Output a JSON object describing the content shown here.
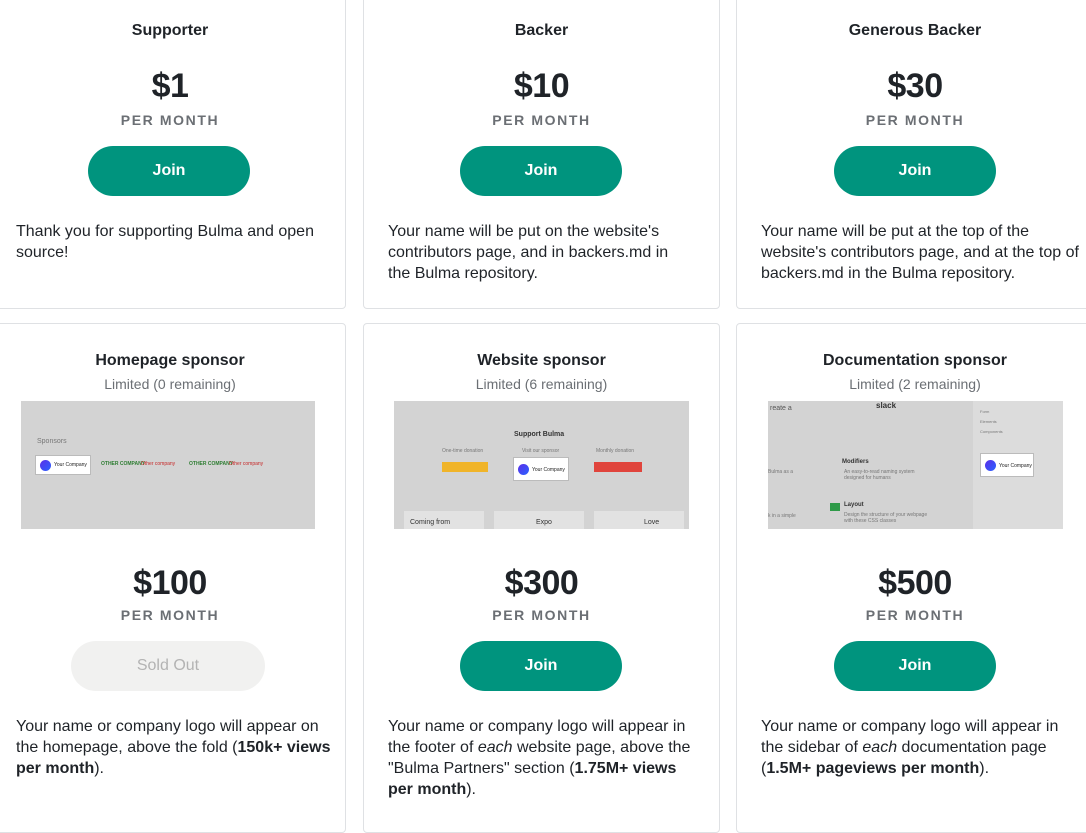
{
  "tiers": [
    {
      "name": "Supporter",
      "price": "$1",
      "period": "PER MONTH",
      "button": "Join",
      "desc": "Thank you for supporting Bulma and open source!"
    },
    {
      "name": "Backer",
      "price": "$10",
      "period": "PER MONTH",
      "button": "Join",
      "desc": "Your name will be put on the website's contributors page, and in backers.md in the Bulma repository."
    },
    {
      "name": "Generous Backer",
      "price": "$30",
      "period": "PER MONTH",
      "button": "Join",
      "desc": "Your name will be put at the top of the website's contributors page, and at the top of backers.md in the Bulma repository."
    },
    {
      "name": "Homepage sponsor",
      "limited": "Limited (0 remaining)",
      "price": "$100",
      "period": "PER MONTH",
      "button": "Sold Out",
      "desc_1": "Your name or company logo will appear on the homepage, above the fold (",
      "desc_bold": "150k+ views per month",
      "desc_2": ").",
      "preview": {
        "label": "Sponsors",
        "your_company": "Your Company",
        "other_company": "Other company",
        "other_company_2": "OTHER COMPANY"
      }
    },
    {
      "name": "Website sponsor",
      "limited": "Limited (6 remaining)",
      "price": "$300",
      "period": "PER MONTH",
      "button": "Join",
      "desc_1": "Your name or company logo will appear in the footer of ",
      "desc_em": "each",
      "desc_2": " website page, above the \"Bulma Partners\" section (",
      "desc_bold": "1.75M+ views per month",
      "desc_3": ").",
      "preview": {
        "title": "Support Bulma",
        "one_time": "One-time donation",
        "visit": "Visit our sponsor",
        "monthly": "Monthly donation",
        "paypal": "PayPal Donate",
        "your_company": "Your Company",
        "coming_from": "Coming from",
        "expo": "Expo",
        "love": "Love"
      }
    },
    {
      "name": "Documentation sponsor",
      "limited": "Limited (2 remaining)",
      "price": "$500",
      "period": "PER MONTH",
      "button": "Join",
      "desc_1": "Your name or company logo will appear in the sidebar of ",
      "desc_em": "each",
      "desc_2": " documentation page (",
      "desc_bold": "1.5M+ pageviews per month",
      "desc_3": ").",
      "preview": {
        "create": "reate a",
        "slack": "slack",
        "modifiers": "Modifiers",
        "modifiers_desc": "An easy-to-read naming system designed for humans",
        "layout": "Layout",
        "layout_desc": "Design the structure of your webpage with these CSS classes",
        "bulma_as": "Bulma as a",
        "in_simple": "k in a simple",
        "menu": [
          "Form",
          "Elements",
          "Components"
        ],
        "your_company": "Your Company"
      }
    }
  ],
  "colors": {
    "primary": "#00947e",
    "soldout_bg": "#f1f1f0",
    "muted": "#6b6f74"
  }
}
